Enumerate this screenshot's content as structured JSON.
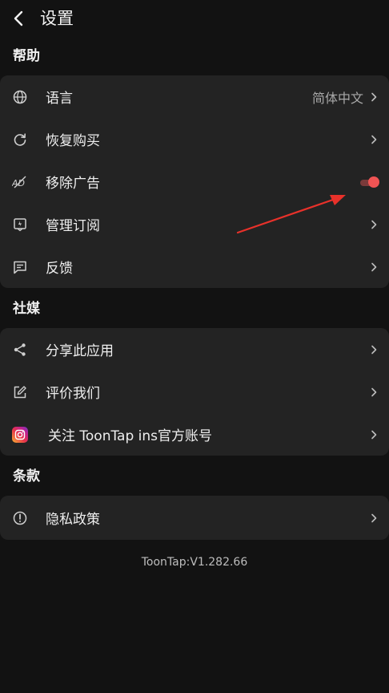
{
  "header": {
    "title": "设置",
    "back_icon": "chevron-left-icon"
  },
  "sections": [
    {
      "title": "帮助",
      "items": [
        {
          "label": "语言",
          "icon": "globe-icon",
          "value": "简体中文",
          "control": "chevron"
        },
        {
          "label": "恢复购买",
          "icon": "refresh-icon",
          "control": "chevron"
        },
        {
          "label": "移除广告",
          "icon": "no-ads-icon",
          "control": "toggle",
          "toggle_on": true
        },
        {
          "label": "管理订阅",
          "icon": "subscription-icon",
          "control": "chevron"
        },
        {
          "label": "反馈",
          "icon": "feedback-icon",
          "control": "chevron"
        }
      ]
    },
    {
      "title": "社媒",
      "items": [
        {
          "label": "分享此应用",
          "icon": "share-icon",
          "control": "chevron"
        },
        {
          "label": "评价我们",
          "icon": "edit-icon",
          "control": "chevron"
        },
        {
          "label": "关注 ToonTap ins官方账号",
          "icon": "instagram-icon",
          "control": "chevron"
        }
      ]
    },
    {
      "title": "条款",
      "items": [
        {
          "label": "隐私政策",
          "icon": "info-circle-icon",
          "control": "chevron"
        }
      ]
    }
  ],
  "footer": {
    "version": "ToonTap:V1.282.66"
  },
  "colors": {
    "background": "#121212",
    "card": "#232323",
    "toggle_accent": "#f05454",
    "annotation_arrow": "#e8312a"
  }
}
